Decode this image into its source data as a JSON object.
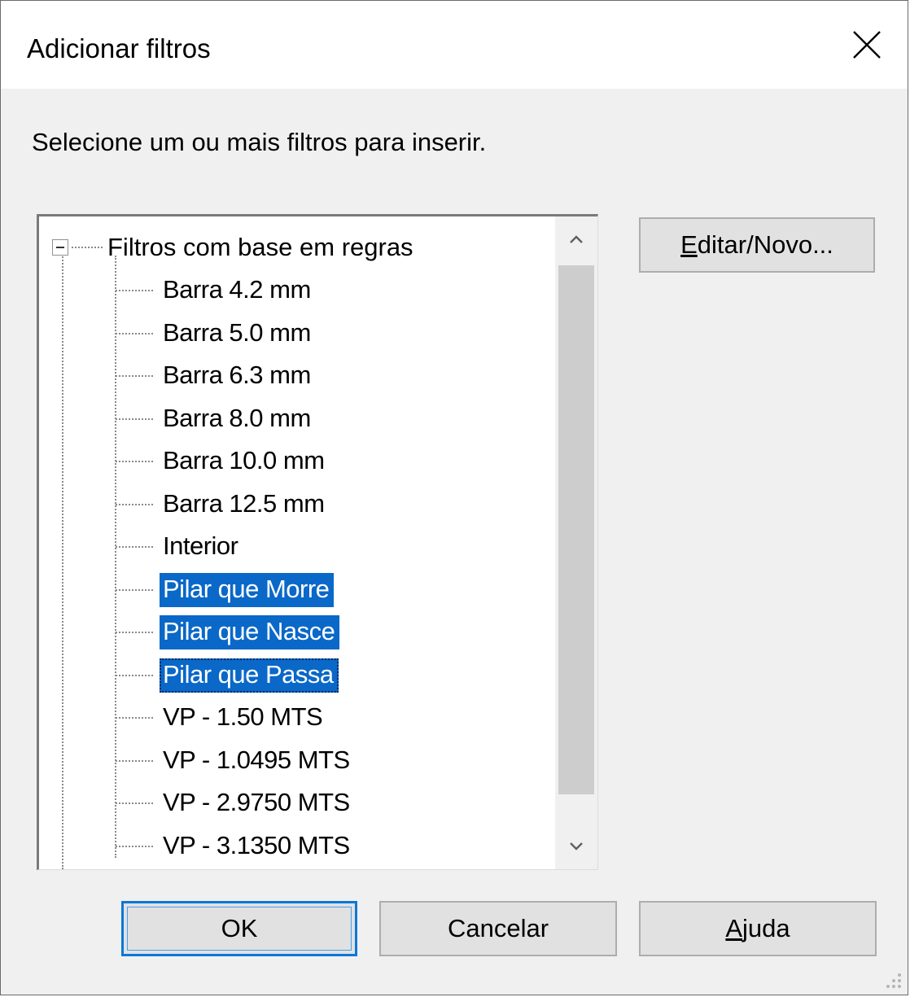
{
  "window": {
    "title": "Adicionar filtros",
    "close_icon": "close-icon"
  },
  "instruction": "Selecione um ou mais filtros para inserir.",
  "tree": {
    "root_label": "Filtros com base em regras",
    "items": [
      {
        "label": "Barra 4.2 mm",
        "selected": false
      },
      {
        "label": "Barra 5.0 mm",
        "selected": false
      },
      {
        "label": "Barra 6.3 mm",
        "selected": false
      },
      {
        "label": "Barra 8.0 mm",
        "selected": false
      },
      {
        "label": "Barra 10.0 mm",
        "selected": false
      },
      {
        "label": "Barra 12.5 mm",
        "selected": false
      },
      {
        "label": "Interior",
        "selected": false
      },
      {
        "label": "Pilar que Morre",
        "selected": true
      },
      {
        "label": "Pilar que Nasce",
        "selected": true
      },
      {
        "label": "Pilar que Passa",
        "selected": true,
        "focused": true
      },
      {
        "label": "VP - 1.50 MTS",
        "selected": false
      },
      {
        "label": "VP - 1.0495 MTS",
        "selected": false
      },
      {
        "label": "VP - 2.9750 MTS",
        "selected": false
      },
      {
        "label": "VP - 3.1350 MTS",
        "selected": false
      }
    ]
  },
  "buttons": {
    "edit_new": {
      "accel": "E",
      "rest": "ditar/Novo..."
    },
    "ok": "OK",
    "cancel": "Cancelar",
    "help": {
      "accel": "A",
      "rest": "juda"
    }
  },
  "colors": {
    "selection": "#0a68c8",
    "default_button_border": "#0a78d7"
  }
}
